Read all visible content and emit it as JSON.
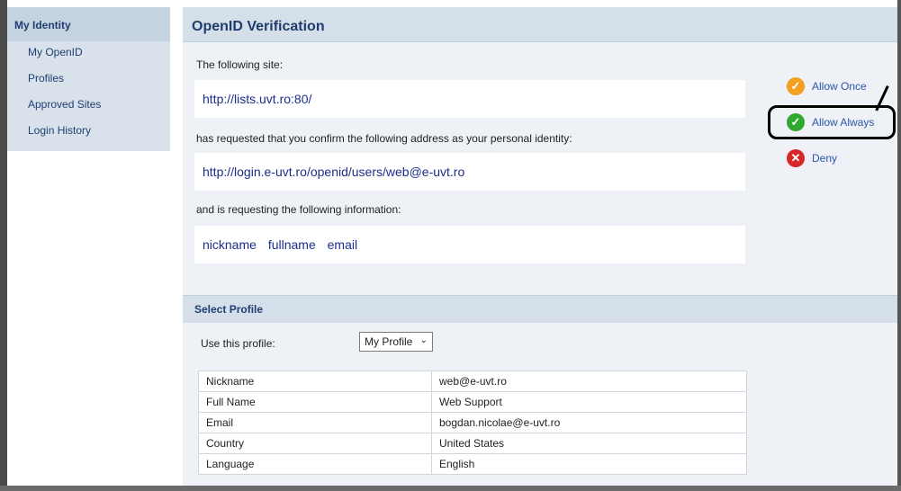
{
  "sidebar": {
    "heading": "My Identity",
    "items": [
      {
        "label": "My OpenID"
      },
      {
        "label": "Profiles"
      },
      {
        "label": "Approved Sites"
      },
      {
        "label": "Login History"
      }
    ]
  },
  "main": {
    "title": "OpenID Verification",
    "site_intro": "The following site:",
    "site_url": "http://lists.uvt.ro:80/",
    "identity_intro": "has requested that you confirm the following address as your personal identity:",
    "identity_url": "http://login.e-uvt.ro/openid/users/web@e-uvt.ro",
    "info_intro": "and is requesting the following information:",
    "info_fields": [
      "nickname",
      "fullname",
      "email"
    ]
  },
  "actions": {
    "allow_once": "Allow Once",
    "allow_always": "Allow Always",
    "deny": "Deny"
  },
  "profile": {
    "section_title": "Select Profile",
    "use_label": "Use this profile:",
    "selected": "My Profile",
    "rows": [
      {
        "key": "Nickname",
        "value": "web@e-uvt.ro"
      },
      {
        "key": "Full Name",
        "value": "Web Support"
      },
      {
        "key": "Email",
        "value": "bogdan.nicolae@e-uvt.ro"
      },
      {
        "key": "Country",
        "value": "United States"
      },
      {
        "key": "Language",
        "value": "English"
      }
    ]
  },
  "colors": {
    "accent": "#1e3d6e",
    "link": "#2a56a8",
    "allow_once": "#f5a020",
    "allow_always": "#2fa82f",
    "deny": "#d62828"
  }
}
